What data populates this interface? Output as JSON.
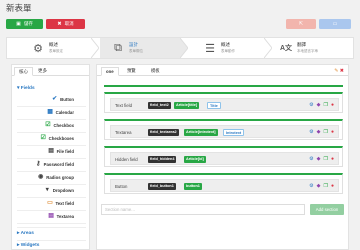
{
  "page": {
    "title": "新表單"
  },
  "toolbar": {
    "save_label": "儲存",
    "cancel_label": "取消"
  },
  "steps": [
    {
      "title": "概述",
      "subtitle": "表單設定",
      "icon": "gear-icon"
    },
    {
      "title": "設計",
      "subtitle": "表單欄位",
      "icon": "design-icon"
    },
    {
      "title": "概述",
      "subtitle": "表單動作",
      "icon": "list-icon"
    },
    {
      "title": "翻譯",
      "subtitle": "本地語言字串",
      "icon": "translate-icon"
    }
  ],
  "left_panel": {
    "tabs": [
      "核心",
      "更多"
    ],
    "sections": {
      "fields": "Fields",
      "areas": "Areas",
      "widgets": "Widgets"
    },
    "fields": [
      {
        "label": "Button",
        "icon": "check-icon",
        "color": "#2a78c2"
      },
      {
        "label": "Calendar",
        "icon": "calendar-icon",
        "color": "#2a78c2"
      },
      {
        "label": "Checkbox",
        "icon": "checkbox-icon",
        "color": "#28a745"
      },
      {
        "label": "Checkboxes",
        "icon": "checkboxes-icon",
        "color": "#28a745"
      },
      {
        "label": "File field",
        "icon": "file-icon",
        "color": "#444444"
      },
      {
        "label": "Password field",
        "icon": "key-icon",
        "color": "#444444"
      },
      {
        "label": "Radios group",
        "icon": "radio-icon",
        "color": "#444444"
      },
      {
        "label": "Dropdown",
        "icon": "dropdown-icon",
        "color": "#444444"
      },
      {
        "label": "Text field",
        "icon": "textfield-icon",
        "color": "#e0903a"
      },
      {
        "label": "Textarea",
        "icon": "textarea-icon",
        "color": "#8e44ad"
      }
    ]
  },
  "main": {
    "tabs": [
      "one",
      "預覽",
      "模板"
    ],
    "rows": [
      {
        "label": "Text field",
        "chips": [
          "field_text2",
          "Article[title]",
          "Title"
        ]
      },
      {
        "label": "Textarea",
        "chips": [
          "field_textarea2",
          "Article[introtext]",
          "Introtext"
        ]
      },
      {
        "label": "Hidden field",
        "chips": [
          "field_hidden4",
          "Article[id]"
        ]
      },
      {
        "label": "Button",
        "chips": [
          "field_button1",
          "button1"
        ]
      }
    ],
    "section_placeholder": "Section name...",
    "add_section_label": "Add section"
  },
  "colors": {
    "primary": "#2a78c2",
    "success": "#28a745",
    "danger": "#dc3545"
  }
}
